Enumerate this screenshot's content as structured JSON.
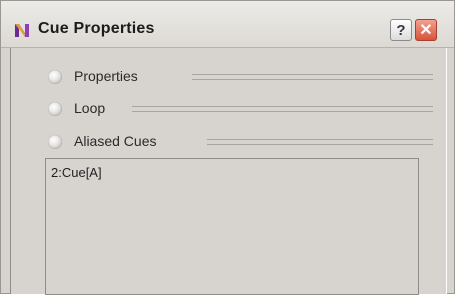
{
  "window": {
    "title": "Cue Properties",
    "help_label": "?",
    "close_label": "✕"
  },
  "sections": [
    {
      "label": "Properties",
      "expanded": false
    },
    {
      "label": "Loop",
      "expanded": false
    },
    {
      "label": "Aliased Cues",
      "expanded": true
    }
  ],
  "aliased_cues": {
    "items": [
      "2:Cue[A]"
    ]
  },
  "colors": {
    "window_bg": "#d7d4d0",
    "close_button": "#d9533a"
  },
  "icons": [
    "app-icon",
    "help-icon",
    "close-icon",
    "collapse-toggle-icon"
  ]
}
